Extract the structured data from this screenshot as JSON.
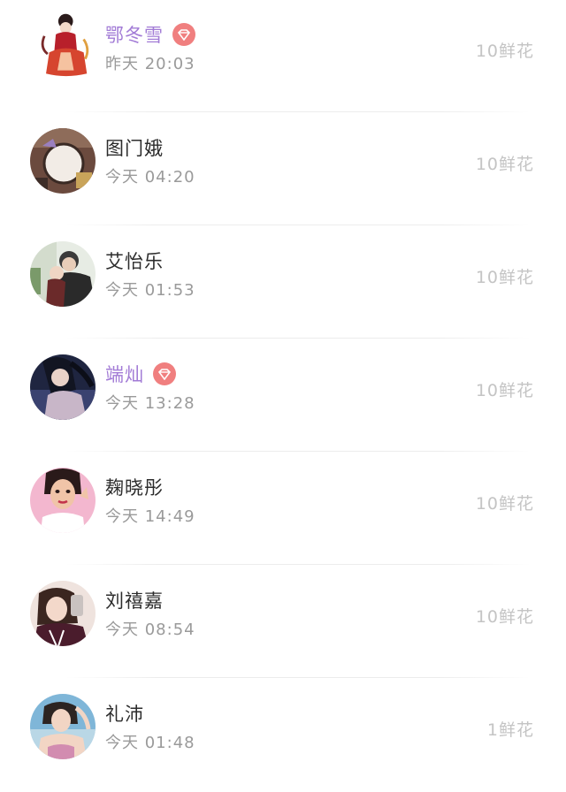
{
  "contacts": [
    {
      "name": "鄂冬雪",
      "vip": true,
      "time": "昨天 20:03",
      "gift": "10鲜花",
      "avatar_icon": "costume-girl-avatar"
    },
    {
      "name": "图门娥",
      "vip": false,
      "time": "今天 04:20",
      "gift": "10鲜花",
      "avatar_icon": "clock-photo-avatar"
    },
    {
      "name": "艾怡乐",
      "vip": false,
      "time": "今天 01:53",
      "gift": "10鲜花",
      "avatar_icon": "couple-photo-avatar"
    },
    {
      "name": "端灿",
      "vip": true,
      "time": "今天 13:28",
      "gift": "10鲜花",
      "avatar_icon": "woman-portrait-avatar"
    },
    {
      "name": "麹晓彤",
      "vip": false,
      "time": "今天 14:49",
      "gift": "10鲜花",
      "avatar_icon": "illustrated-girl-avatar"
    },
    {
      "name": "刘禧嘉",
      "vip": false,
      "time": "今天 08:54",
      "gift": "10鲜花",
      "avatar_icon": "mirror-selfie-avatar"
    },
    {
      "name": "礼沛",
      "vip": false,
      "time": "今天 01:48",
      "gift": "1鲜花",
      "avatar_icon": "girl-outdoor-avatar"
    }
  ],
  "colors": {
    "vip_name": "#a27bd6",
    "vip_badge": "#f07f7f",
    "name": "#2c2c2c",
    "time": "#9a9a9a",
    "gift": "#c4c4c4"
  }
}
